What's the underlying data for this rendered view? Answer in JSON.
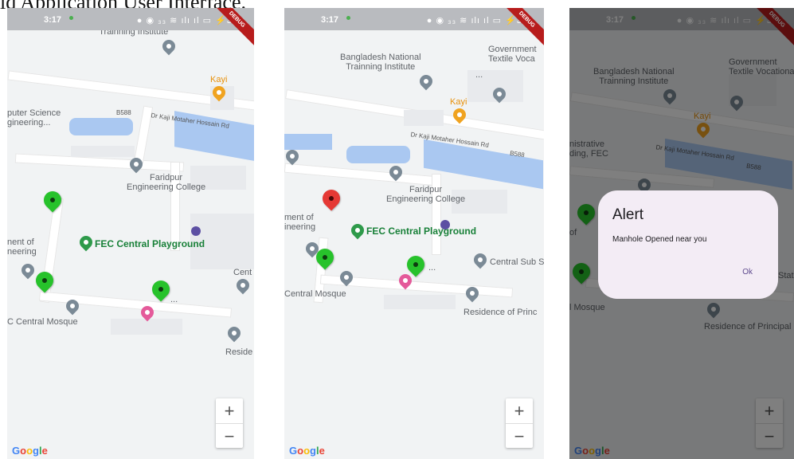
{
  "caption": "id Application User Interface.",
  "status_bar": {
    "time": "3:17",
    "icons": "● ◉ ₃₃ ≋ ılı ıl ▭ ⚡34"
  },
  "debug_label": "DEBUG",
  "google_logo": [
    "G",
    "o",
    "o",
    "g",
    "l",
    "e"
  ],
  "zoom": {
    "in_label": "+",
    "out_label": "−"
  },
  "screen1": {
    "labels": {
      "bangladesh": "Bangladesh National\nTrainning Institute",
      "kayi": "Kayi",
      "cse": "puter Science\ngineering...",
      "b588": "B588",
      "dr_kaji": "Dr Kaji Motaher Hossain Rd",
      "faridpur": "Faridpur\nEngineering College",
      "fec_playground": "FEC Central Playground",
      "ment_of": "nent of\nneering",
      "cent": "Cent",
      "ellipsis": "...",
      "fec_mosque": "C Central Mosque",
      "reside": "Reside"
    }
  },
  "screen2": {
    "labels": {
      "bangladesh": "Bangladesh National\nTrainning Institute",
      "government": "Government\nTextile Voca",
      "kayi": "Kayi",
      "ellipsis_top": "...",
      "dr_kaji": "Dr Kaji Motaher Hossain Rd",
      "b588": "B588",
      "faridpur": "Faridpur\nEngineering College",
      "ment_of": "ment of\nineering",
      "fec_playground": "FEC Central Playground",
      "central_sub": "Central Sub S",
      "ellipsis_pin": "...",
      "central_mosque": "Central Mosque",
      "residence": "Residence of Princ"
    }
  },
  "screen3": {
    "labels": {
      "bangladesh": "Bangladesh National\nTrainning Institute",
      "government": "Government\nTextile Vocationa",
      "kayi": "Kayi",
      "nistrative": "nistrative\nding, FEC",
      "dr_kaji": "Dr Kaji Motaher Hossain Rd",
      "b588": "B588",
      "of": "of",
      "stat": "Stat",
      "mosque": "l Mosque",
      "residence": "Residence of Principal"
    },
    "alert": {
      "title": "Alert",
      "message": "Manhole Opened near you",
      "ok_label": "Ok"
    }
  },
  "colors": {
    "pin_green": "#27c22b",
    "pin_red": "#e53935",
    "water": "#aac8f1",
    "poi_gray": "#7b8a96",
    "poi_orange": "#f0a320",
    "poi_pink": "#e45a9a",
    "dialog_bg": "#f3ecf5"
  }
}
